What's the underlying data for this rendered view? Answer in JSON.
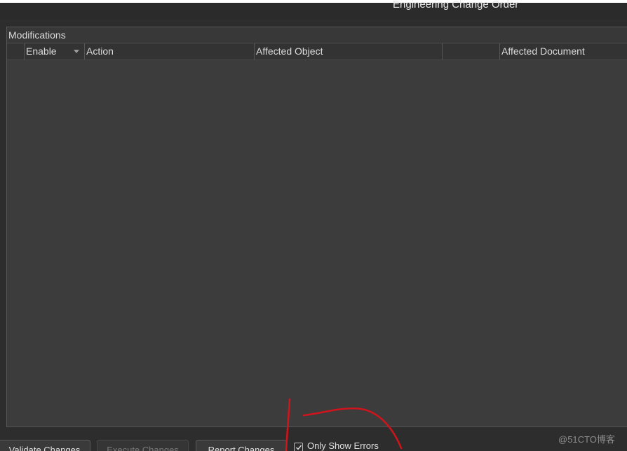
{
  "window": {
    "title": "Engineering Change Order"
  },
  "modifications": {
    "group_label": "Modifications",
    "columns": [
      "Enable",
      "Action",
      "Affected Object",
      "",
      "Affected Document"
    ],
    "rows": []
  },
  "buttons": {
    "validate_label": "Validate Changes",
    "execute_label": "Execute Changes",
    "report_label": "Report Changes"
  },
  "options": {
    "only_show_errors_label": "Only Show Errors",
    "only_show_errors_checked": true
  },
  "watermark": "@51CTO博客",
  "colors": {
    "annotation_stroke": "#d0141c",
    "background": "#3c3c3c"
  },
  "icons": {
    "sort": "chevron-down-icon",
    "check": "checkmark-icon"
  }
}
